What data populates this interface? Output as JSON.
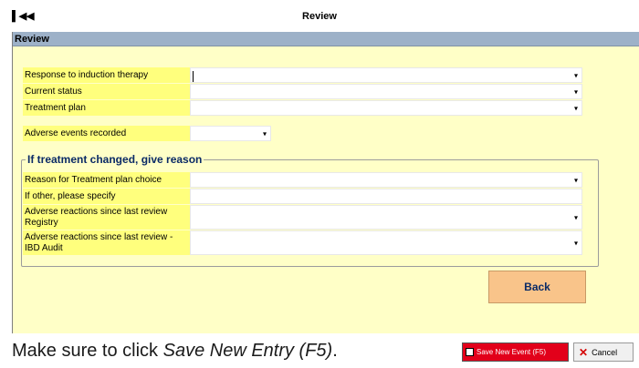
{
  "titlebar": {
    "first_glyph": "⏮",
    "prev_glyph": "◀",
    "title": "Review"
  },
  "section": {
    "header": "Review"
  },
  "fields": {
    "response": {
      "label": "Response to induction therapy",
      "value": ""
    },
    "current_status": {
      "label": "Current status",
      "value": ""
    },
    "treatment_plan": {
      "label": "Treatment plan",
      "value": ""
    },
    "adverse_events": {
      "label": "Adverse events recorded",
      "value": ""
    }
  },
  "group": {
    "title": "If treatment changed, give reason",
    "reason_choice": {
      "label": "Reason for Treatment plan choice",
      "value": ""
    },
    "other_specify": {
      "label": "If other, please specify",
      "value": ""
    },
    "adverse_registry": {
      "label": "Adverse reactions since last review Registry",
      "value": ""
    },
    "adverse_ibd": {
      "label": "Adverse reactions since last review - IBD Audit",
      "value": ""
    }
  },
  "dropdown_arrow": "▾",
  "buttons": {
    "back": "Back",
    "save": "Save New Event (F5)",
    "cancel": "Cancel"
  },
  "instruction": {
    "prefix": "Make sure to click ",
    "emphasis": "Save New Entry (F5)",
    "suffix": "."
  },
  "colors": {
    "panel_bg": "#ffffc7",
    "label_bg": "#ffff7d",
    "header_bg": "#9db1c8",
    "back_btn": "#f9c48a",
    "save_btn": "#e2001a"
  }
}
